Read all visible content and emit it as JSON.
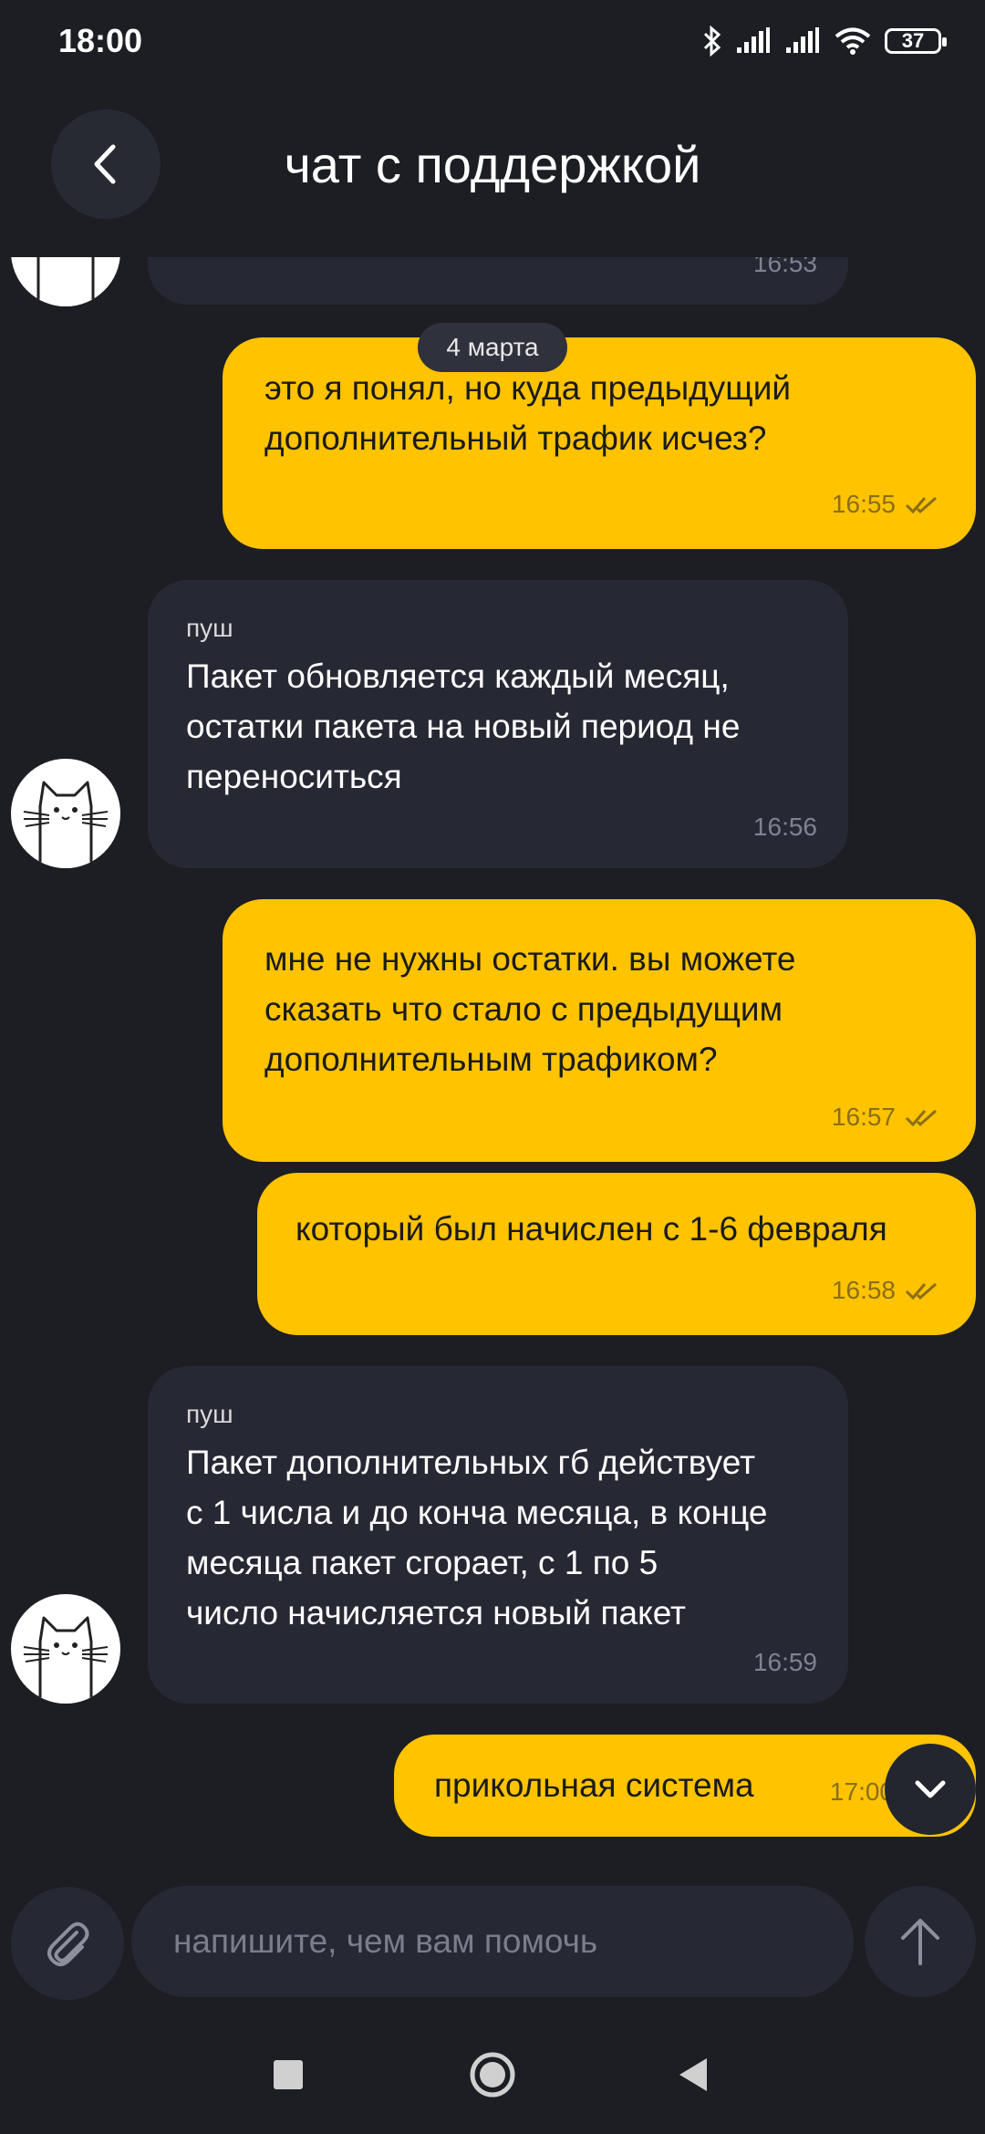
{
  "status_bar": {
    "time": "18:00",
    "battery": "37"
  },
  "header": {
    "title": "чат с поддержкой"
  },
  "date_separator": "4 марта",
  "messages": [
    {
      "type": "incoming",
      "time": "16:53"
    },
    {
      "type": "outgoing",
      "text_lines": [
        "это я понял, но куда предыдущий",
        "дополнительный трафик исчез?"
      ],
      "time": "16:55"
    },
    {
      "type": "incoming",
      "sender": "пуш",
      "text_lines": [
        "Пакет обновляется каждый месяц,",
        "остатки пакета на новый период не",
        "переноситься"
      ],
      "time": "16:56"
    },
    {
      "type": "outgoing",
      "text_lines": [
        "мне не нужны остатки. вы можете",
        "сказать что стало с предыдущим",
        "дополнительным трафиком?"
      ],
      "time": "16:57"
    },
    {
      "type": "outgoing",
      "text_lines": [
        "который был начислен с 1-6 февраля"
      ],
      "time": "16:58"
    },
    {
      "type": "incoming",
      "sender": "пуш",
      "text_lines": [
        "Пакет дополнительных гб действует",
        "с 1 числа и до конча месяца, в конце",
        "месяца пакет сгорает, с 1 по 5",
        "число начисляется новый пакет"
      ],
      "time": "16:59"
    },
    {
      "type": "outgoing",
      "text_lines": [
        "прикольная система"
      ],
      "time": "17:00"
    }
  ],
  "composer": {
    "placeholder": "напишите, чем вам помочь"
  },
  "colors": {
    "background": "#1c1e24",
    "incoming_bubble": "#262934",
    "outgoing_bubble": "#ffc300"
  },
  "icons": [
    "bluetooth-icon",
    "signal-icon",
    "wifi-icon",
    "battery-icon",
    "back-arrow-icon",
    "cat-avatar-icon",
    "double-check-icon",
    "scroll-down-icon",
    "paperclip-icon",
    "send-arrow-icon",
    "nav-recents-icon",
    "nav-home-icon",
    "nav-back-icon"
  ]
}
